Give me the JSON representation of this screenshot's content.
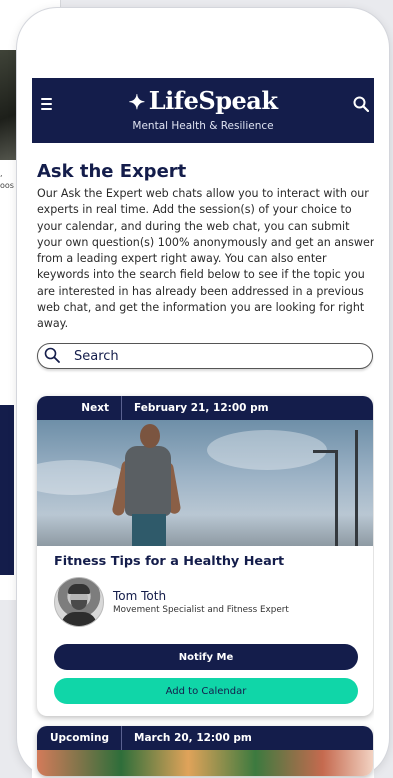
{
  "app": {
    "brand": "LifeSpeak",
    "tagline": "Mental Health & Resilience"
  },
  "background": {
    "snippet_lines": [
      ",",
      "oos"
    ]
  },
  "page": {
    "title": "Ask the Expert",
    "intro": "Our Ask the Expert web chats allow you to interact with our experts in real time. Add the session(s) of your choice to your calendar, and during the web chat, you can submit your own question(s) 100% anonymously and get an answer from a leading expert right away. You can also enter keywords into the search field below to see if the topic you are interested in has already been addressed in a previous web chat, and get the information you are looking for right away."
  },
  "search": {
    "placeholder": "Search"
  },
  "sessions": [
    {
      "tag": "Next",
      "date": "February 21, 12:00 pm",
      "title": "Fitness Tips for a Healthy Heart",
      "speaker_name": "Tom Toth",
      "speaker_role": "Movement Specialist and Fitness Expert",
      "notify_label": "Notify Me",
      "calendar_label": "Add to Calendar"
    },
    {
      "tag": "Upcoming",
      "date": "March 20, 12:00 pm"
    }
  ],
  "colors": {
    "navy": "#141d4b",
    "accent": "#10d6a8"
  },
  "icons": {
    "menu": "hamburger-icon",
    "search": "search-icon",
    "star": "star-icon"
  }
}
